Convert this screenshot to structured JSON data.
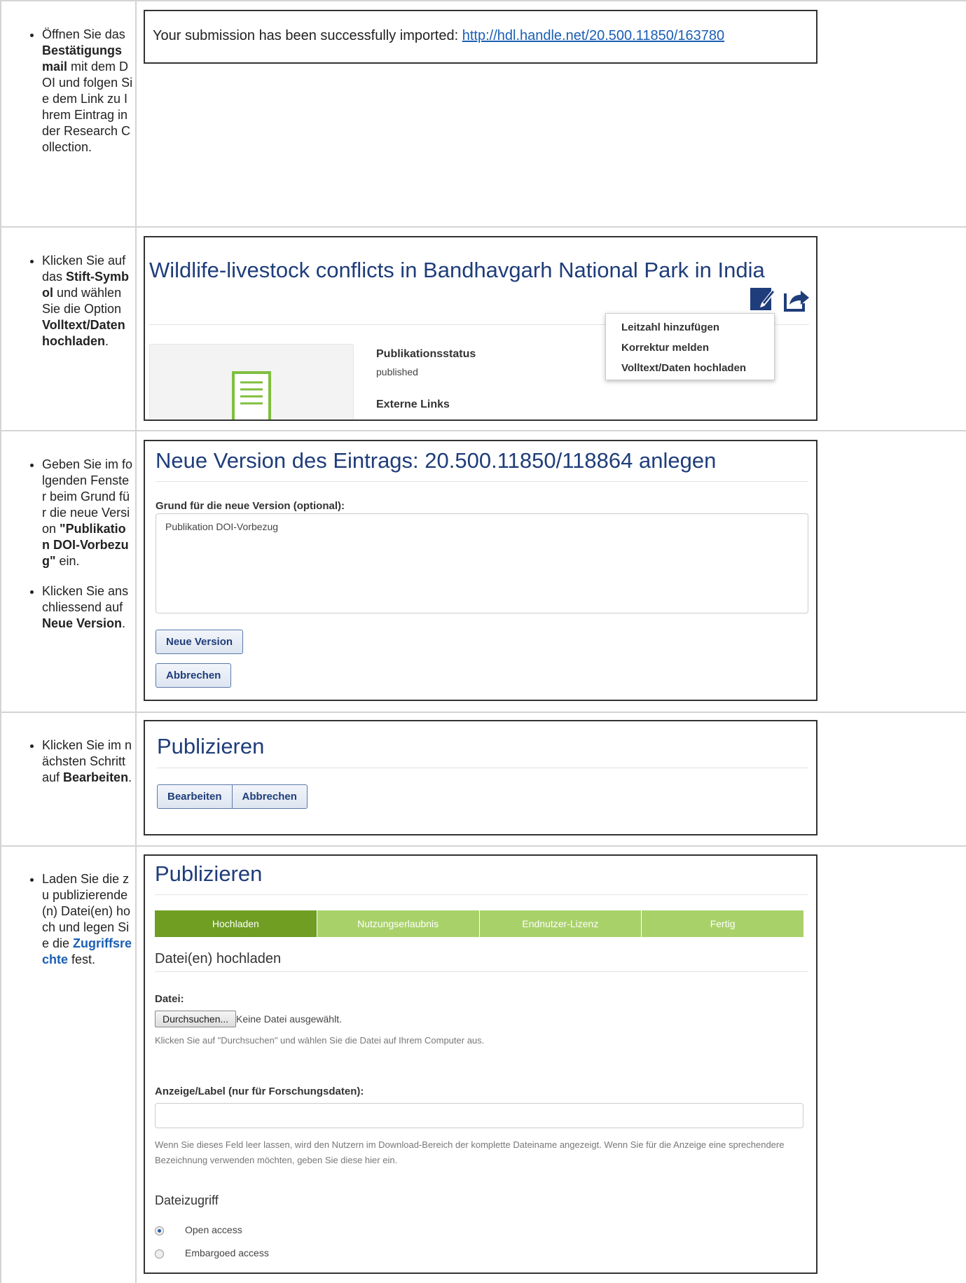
{
  "steps": [
    {
      "html": "Öffnen Sie das <b>Bestätigungsmail</b> mit dem DOI und folgen Sie dem Link zu Ihrem Eintrag in der Research Collection."
    },
    {
      "html": "Klicken Sie auf das <b>Stift-Symbol</b> und wählen Sie die Option <b>Volltext/Daten hochladen</b>."
    },
    {
      "html": "Geben Sie im folgenden Fenster beim Grund für die neue Version <b>\"Publikation DOI-Vorbezug\"</b> ein."
    },
    {
      "html": "Klicken Sie anschliessend auf <b>Neue Version</b>."
    },
    {
      "html": "Klicken Sie im nächsten Schritt auf <b>Bearbeiten</b>."
    },
    {
      "html": "Laden Sie die zu publizierende (n) Datei(en) hoch und legen Sie die <span class=\"lnk\">Zugriffsrechte</span> fest."
    }
  ],
  "shot1": {
    "text": "Your submission has been successfully imported: ",
    "link": "http://hdl.handle.net/20.500.11850/163780"
  },
  "shot2": {
    "title": "Wildlife-livestock conflicts in Bandhavgarh National Park in India",
    "menu": [
      "Leitzahl hinzufügen",
      "Korrektur melden",
      "Volltext/Daten hochladen"
    ],
    "status_label": "Publikationsstatus",
    "status_value": "published",
    "links_label": "Externe Links"
  },
  "shot3": {
    "title": "Neue Version des Eintrags: 20.500.11850/118864 anlegen",
    "field_label": "Grund für die neue Version (optional):",
    "field_value": "Publikation DOI-Vorbezug",
    "btn_new": "Neue Version",
    "btn_cancel": "Abbrechen"
  },
  "shot4": {
    "title": "Publizieren",
    "btn_edit": "Bearbeiten",
    "btn_cancel": "Abbrechen"
  },
  "shot5": {
    "title": "Publizieren",
    "progress": [
      "Hochladen",
      "Nutzungserlaubnis",
      "Endnutzer-Lizenz",
      "Fertig"
    ],
    "section_title": "Datei(en) hochladen",
    "file_label": "Datei:",
    "browse_button": "Durchsuchen...",
    "no_file": "Keine Datei ausgewählt.",
    "file_help": "Klicken Sie auf \"Durchsuchen\" und wählen Sie die Datei auf Ihrem Computer aus.",
    "label_label": "Anzeige/Label (nur für Forschungsdaten):",
    "label_help": "Wenn Sie dieses Feld leer lassen, wird den Nutzern im Download-Bereich der komplette Dateiname angezeigt. Wenn Sie für die Anzeige eine sprechendere Bezeichnung verwenden möchten, geben Sie diese hier ein.",
    "access_title": "Dateizugriff",
    "access_options": [
      "Open access",
      "Embargoed access"
    ]
  },
  "colors": {
    "navy": "#1f3d7a",
    "green_dark": "#6f9e22",
    "green_light": "#a9d16a",
    "link": "#1a5fb4"
  }
}
